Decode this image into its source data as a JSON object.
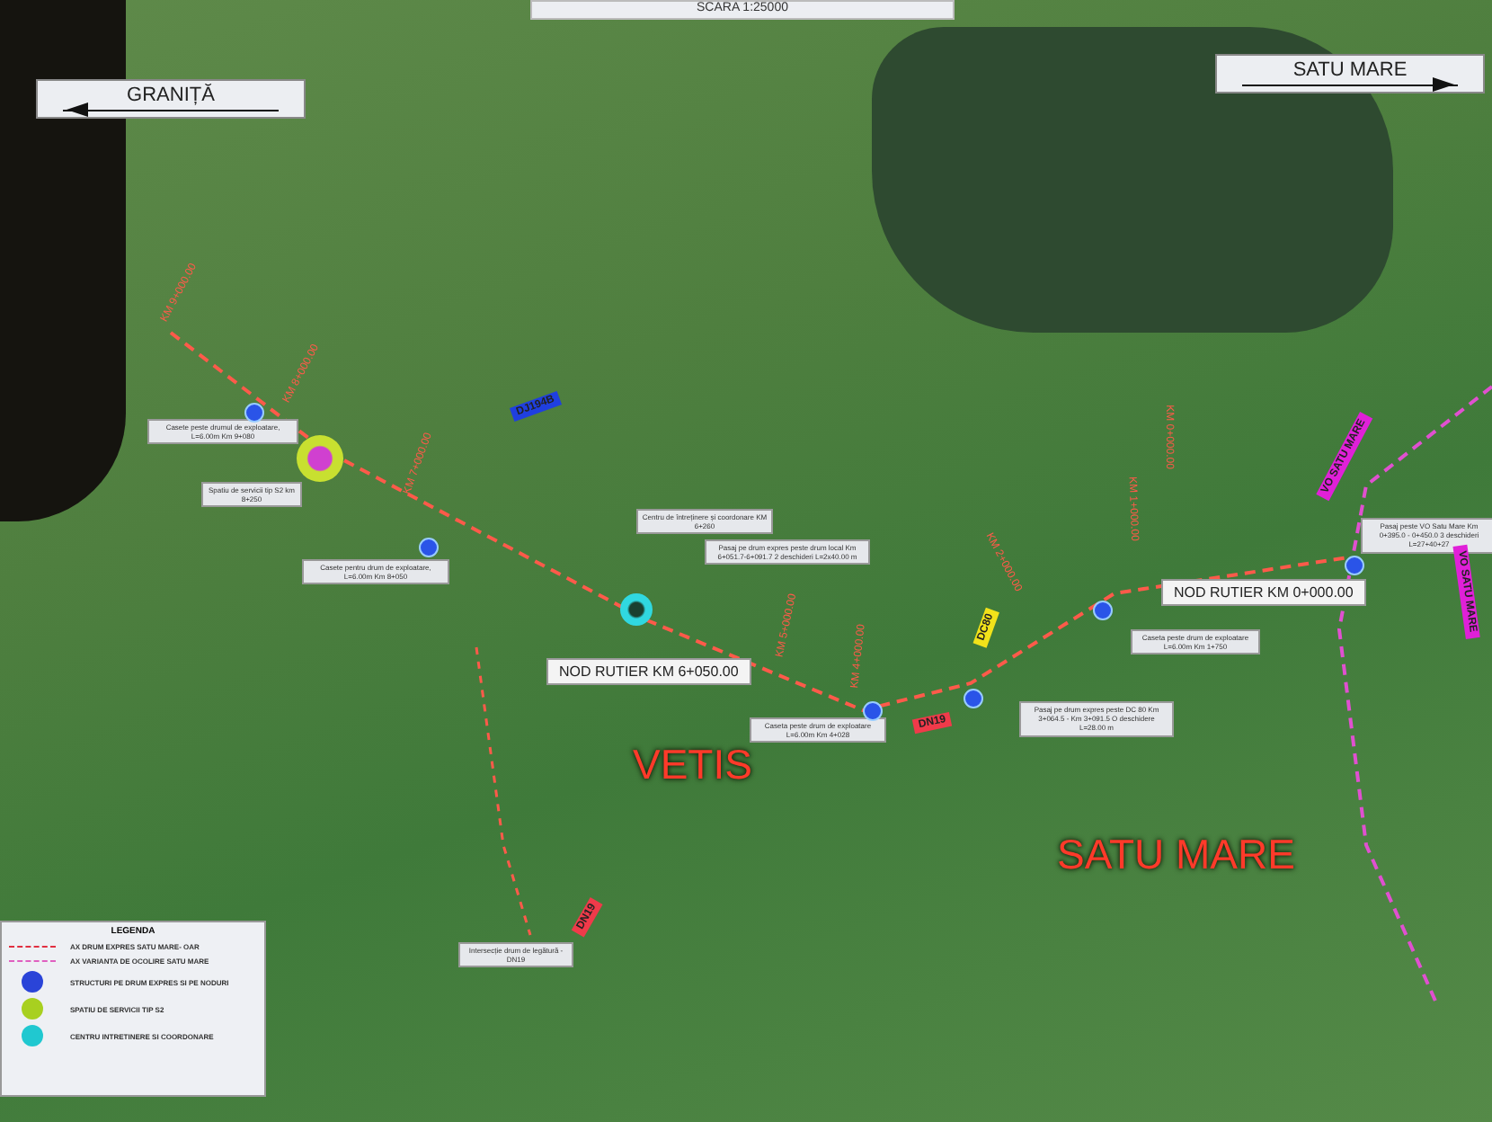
{
  "scale_banner": {
    "text": "SCARA 1:25000"
  },
  "direction_signs": [
    {
      "text": "GRANIȚĂ",
      "kind": "left"
    },
    {
      "text": "SATU MARE",
      "kind": "right"
    }
  ],
  "place_names": [
    "VETIS",
    "SATU MARE"
  ],
  "road_nodes": [
    "NOD RUTIER KM 6+050.00",
    "NOD RUTIER KM 0+000.00"
  ],
  "info_boxes": [
    "Casete peste drumul de exploatare, L=6.00m Km 9+080",
    "Spatiu de servicii tip S2 km 8+250",
    "Casete pentru drum de exploatare, L=6.00m Km 8+050",
    "Centru de întreținere și coordonare KM 6+260",
    "Pasaj pe drum expres peste drum local Km 6+051.7-6+091.7 2 deschideri L=2x40.00 m",
    "Caseta peste drum de exploatare L=6.00m Km 4+028",
    "Pasaj pe drum expres peste DC 80 Km 3+064.5 - Km 3+091.5 O deschidere L=28.00 m",
    "Caseta peste drum de exploatare L=6.00m Km 1+750",
    "Pasaj peste VO Satu Mare Km 0+395.0 - 0+450.0 3 deschideri L=27+40+27",
    "Intersecție drum de legătură - DN19"
  ],
  "road_tags": [
    {
      "text": "DJ194B",
      "color": "#1f3fe0"
    },
    {
      "text": "DN19",
      "color": "#f03a4a"
    },
    {
      "text": "DC80",
      "color": "#f2e21a"
    },
    {
      "text": "VO SATU MARE",
      "color": "#e020d8"
    },
    {
      "text": "VO SATU MARE",
      "color": "#e020d8"
    },
    {
      "text": "DN19",
      "color": "#f03a4a"
    }
  ],
  "km_markers": [
    "KM 9+000.00",
    "KM 8+000.00",
    "KM 7+000.00",
    "KM 5+000.00",
    "KM 4+000.00",
    "KM 2+000.00",
    "KM 1+000.00",
    "KM 0+000.00"
  ],
  "legend": {
    "title": "LEGENDA",
    "items": [
      {
        "kind": "line",
        "color": "#e03040",
        "label": "AX DRUM EXPRES SATU MARE- OAR"
      },
      {
        "kind": "line",
        "color": "#e060c0",
        "label": "AX VARIANTA DE OCOLIRE SATU MARE"
      },
      {
        "kind": "dot",
        "color": "#2a44d8",
        "label": "STRUCTURI PE DRUM EXPRES SI PE NODURI"
      },
      {
        "kind": "dot",
        "color": "#a8d020",
        "label": "SPATIU DE SERVICII TIP S2"
      },
      {
        "kind": "dot",
        "color": "#20c8d0",
        "label": "CENTRU INTRETINERE SI COORDONARE"
      }
    ]
  }
}
